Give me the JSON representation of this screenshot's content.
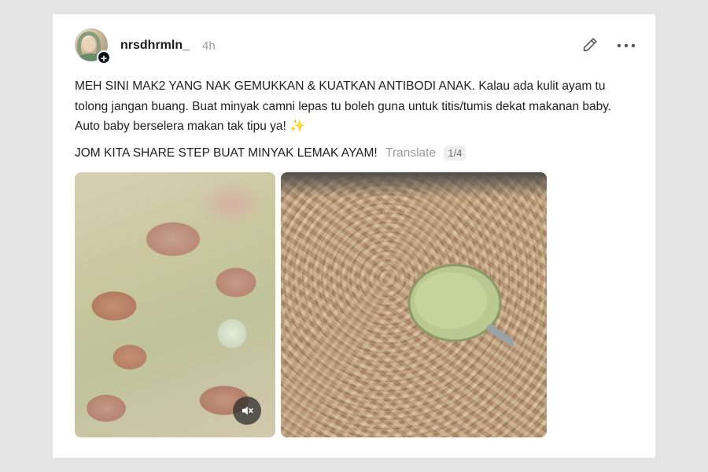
{
  "post": {
    "username": "nrsdhrmln_",
    "timestamp": "4h",
    "body": "MEH SINI MAK2 YANG NAK GEMUKKAN & KUATKAN ANTIBODI ANAK. Kalau ada kulit ayam tu tolong jangan buang. Buat minyak camni lepas tu boleh guna untuk titis/tumis dekat makanan baby. Auto baby berselera makan tak tipu ya!",
    "emoji": "✨",
    "headline": "JOM KITA SHARE STEP BUAT MINYAK LEMAK AYAM!",
    "translate_label": "Translate",
    "media_counter": "1/4"
  },
  "icons": {
    "avatar": "profile-photo",
    "follow": "plus-icon",
    "edit": "pencil-icon",
    "more": "more-horizontal-icon",
    "mute": "speaker-muted-icon"
  },
  "colors": {
    "background": "#e4e4e4",
    "card": "#ffffff",
    "text": "#222222",
    "muted": "#9a9a9a"
  }
}
